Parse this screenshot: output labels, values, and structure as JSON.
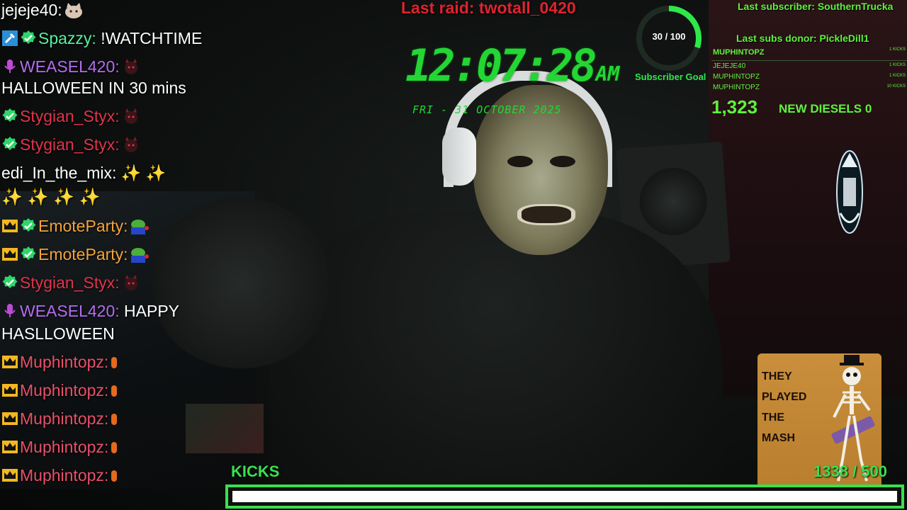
{
  "chat": {
    "messages": [
      {
        "user": "jejeje40:",
        "color": "#ffffff",
        "text": "",
        "badges": [],
        "emote": "cat"
      },
      {
        "user": "Spazzy:",
        "color": "#57f0a0",
        "text": " !WATCHTIME",
        "badges": [
          "tool-icon",
          "verified-icon"
        ]
      },
      {
        "user": "WEASEL420:",
        "color": "#b56cf0",
        "text": "",
        "badges": [
          "mic-icon"
        ]
      },
      {
        "text": "HALLOWEEN IN 30 mins"
      },
      {
        "user": "Stygian_Styx:",
        "color": "#e0334a",
        "text": "",
        "badges": [
          "verified-icon"
        ]
      },
      {
        "user": "Stygian_Styx:",
        "color": "#e0334a",
        "text": "",
        "badges": [
          "verified-icon"
        ]
      },
      {
        "user": "edi_In_the_mix:",
        "color": "#ffffff",
        "text": " ✨ ✨",
        "badges": []
      },
      {
        "text": "✨ ✨ ✨ ✨"
      },
      {
        "user": "EmoteParty:",
        "color": "#f2a33a",
        "text": "",
        "badges": [
          "crown-icon",
          "verified-icon"
        ]
      },
      {
        "user": "EmoteParty:",
        "color": "#f2a33a",
        "text": "",
        "badges": [
          "crown-icon",
          "verified-icon"
        ]
      },
      {
        "user": "Stygian_Styx:",
        "color": "#e0334a",
        "text": "",
        "badges": [
          "verified-icon"
        ]
      },
      {
        "user": "WEASEL420:",
        "color": "#b56cf0",
        "text": " HAPPY",
        "badges": [
          "mic-icon"
        ]
      },
      {
        "text": "HASLLOWEEN"
      },
      {
        "user": "Muphintopz:",
        "color": "#e8506a",
        "text": "",
        "badges": [
          "crown-icon"
        ]
      },
      {
        "user": "Muphintopz:",
        "color": "#e8506a",
        "text": "",
        "badges": [
          "crown-icon"
        ]
      },
      {
        "user": "Muphintopz:",
        "color": "#e8506a",
        "text": "",
        "badges": [
          "crown-icon"
        ]
      },
      {
        "user": "Muphintopz:",
        "color": "#e8506a",
        "text": "",
        "badges": [
          "crown-icon"
        ]
      },
      {
        "user": "Muphintopz:",
        "color": "#e8506a",
        "text": "",
        "badges": [
          "crown-icon"
        ]
      }
    ]
  },
  "raid": {
    "label": "Last raid: twotall_0420"
  },
  "clock": {
    "time": "12:07:28",
    "ampm": "AM",
    "date": "FRI - 31 OCTOBER 2025"
  },
  "subscriber_goal": {
    "count": "30 / 100",
    "current": 30,
    "target": 100,
    "label": "Subscriber Goal"
  },
  "last_subscriber": "Last subscriber: SouthernTrucka",
  "last_subs_donor": "Last subs donor: PickleDill1",
  "kick_list": {
    "top": {
      "name": "MUPHINTOPZ",
      "amount": "1 KICKS"
    },
    "rows": [
      {
        "name": "JEJEJE40",
        "amount": "1 KICKS"
      },
      {
        "name": "MUPHINTOPZ",
        "amount": "1 KICKS"
      },
      {
        "name": "MUPHINTOPZ",
        "amount": "10 KICKS"
      }
    ]
  },
  "follower_count": "1,323",
  "new_diesels": "NEW DIESELS 0",
  "song_card": {
    "title": "THEY PLAYED THE MASH"
  },
  "kicks": {
    "label": "KICKS",
    "count": "1338 / 500",
    "progress": 1.0
  },
  "colors": {
    "accent_green": "#39e04f",
    "raid_red": "#e0232d",
    "clock_green": "#23d633"
  }
}
